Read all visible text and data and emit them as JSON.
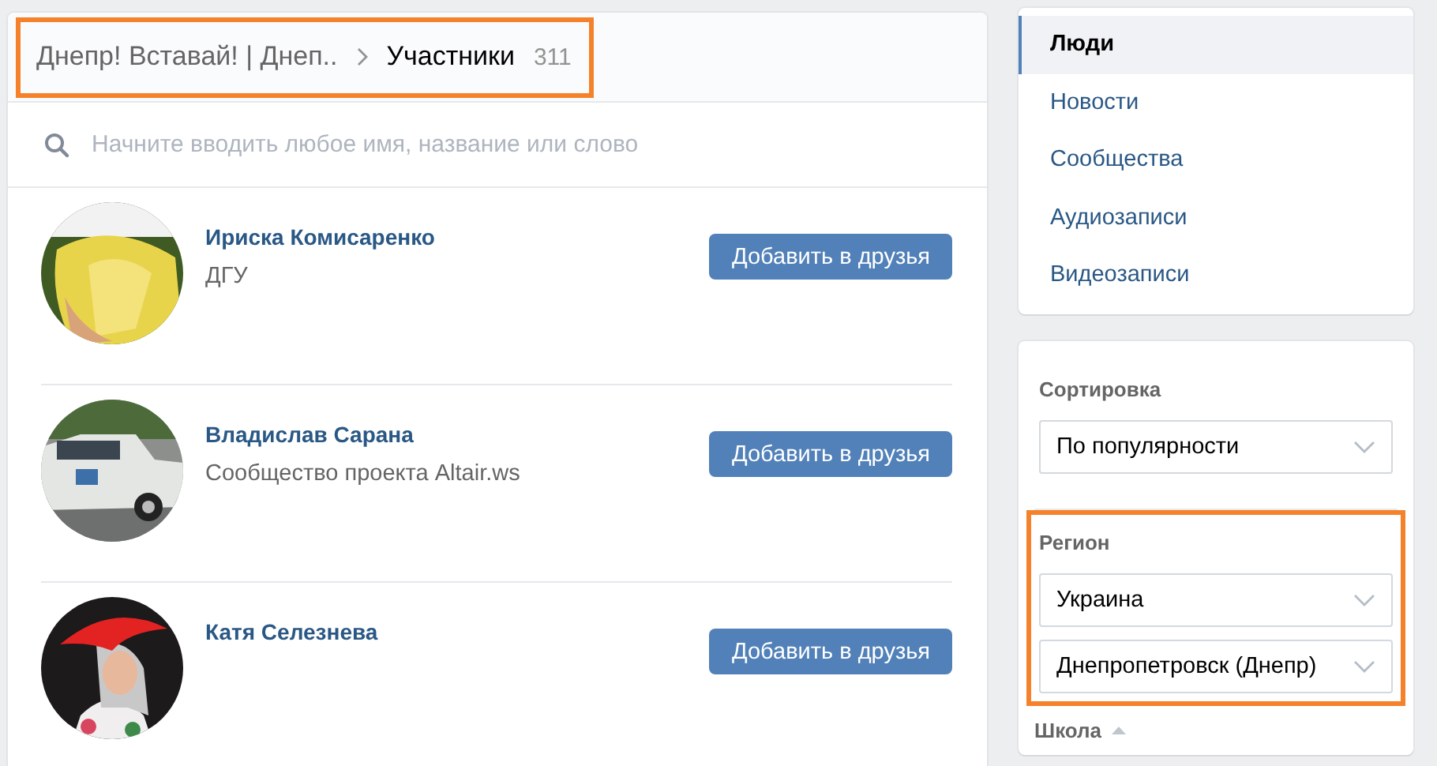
{
  "header": {
    "highlighted": true,
    "breadcrumb": "Днепр! Вставай! | Днеп..",
    "title": "Участники",
    "count": "311"
  },
  "search": {
    "placeholder": "Начните вводить любое имя, название или слово"
  },
  "members": [
    {
      "name": "Ириска Комисаренко",
      "subtitle": "ДГУ",
      "button": "Добавить в друзья"
    },
    {
      "name": "Владислав Сарана",
      "subtitle": "Сообщество проекта Altair.ws",
      "button": "Добавить в друзья"
    },
    {
      "name": "Катя Селезнева",
      "button": "Добавить в друзья"
    }
  ],
  "menu": [
    {
      "label": "Люди",
      "selected": true
    },
    {
      "label": "Новости",
      "selected": false
    },
    {
      "label": "Сообщества",
      "selected": false
    },
    {
      "label": "Аудиозаписи",
      "selected": false
    },
    {
      "label": "Видеозаписи",
      "selected": false
    }
  ],
  "filters": [
    {
      "title": "Сортировка",
      "highlighted": false,
      "selects": [
        "По популярности"
      ]
    },
    {
      "title": "Регион",
      "highlighted": true,
      "selects": [
        "Украина",
        "Днепропетровск (Днепр)"
      ]
    }
  ],
  "school": {
    "title": "Школа"
  }
}
